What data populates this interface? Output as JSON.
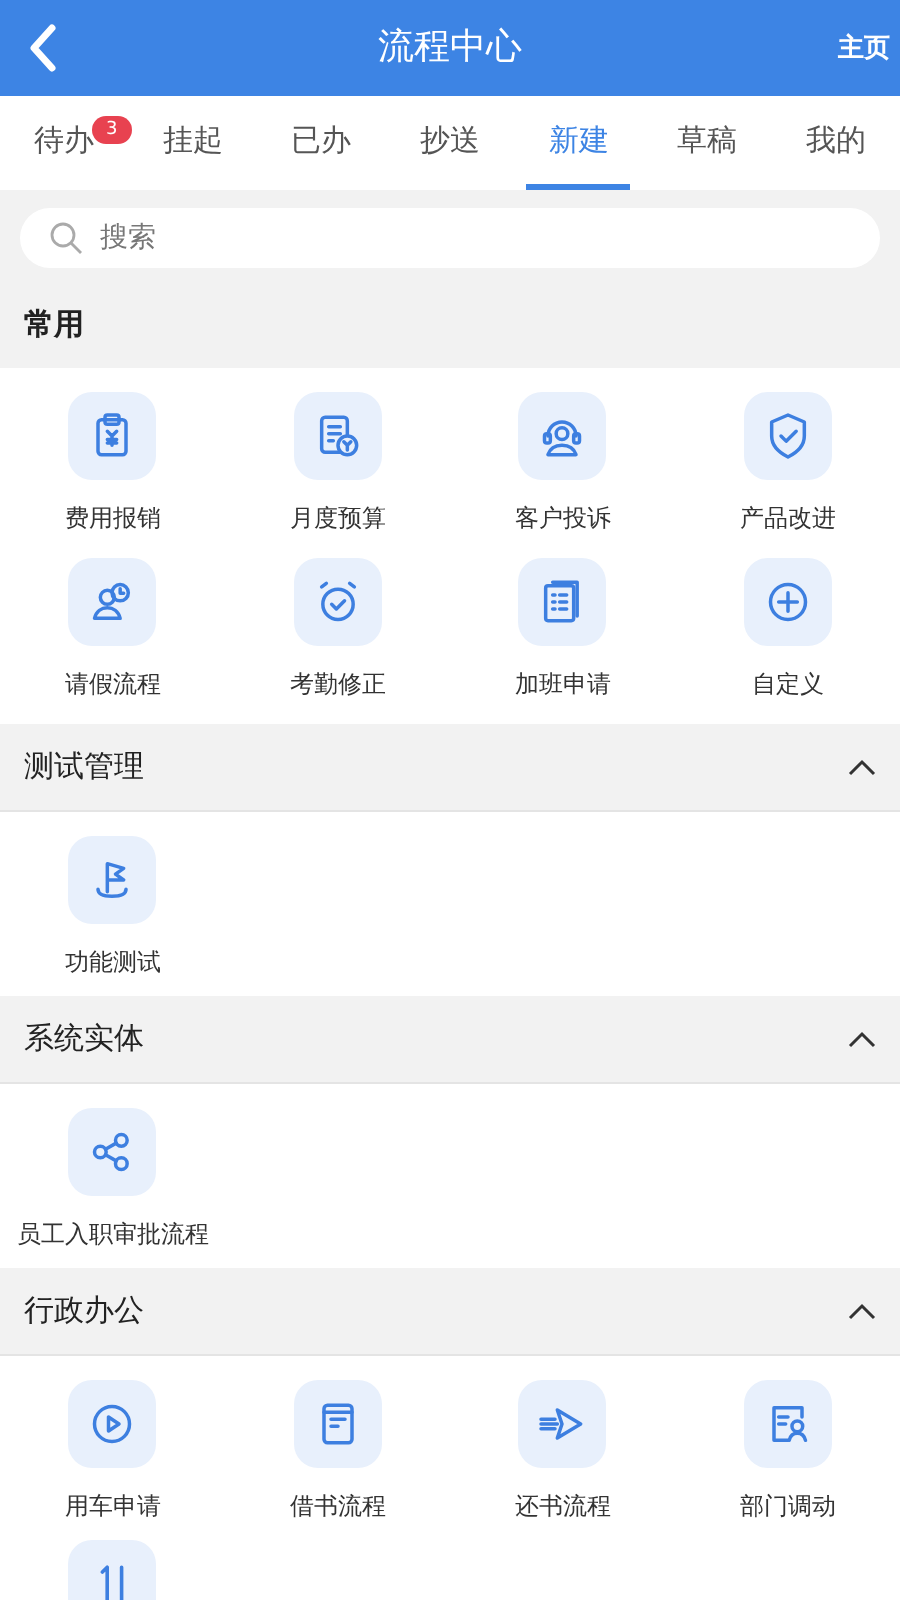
{
  "header": {
    "title": "流程中心",
    "action": "主页"
  },
  "tabs": [
    {
      "label": "待办",
      "badge": "3",
      "selected": false
    },
    {
      "label": "挂起",
      "selected": false
    },
    {
      "label": "已办",
      "selected": false
    },
    {
      "label": "抄送",
      "selected": false
    },
    {
      "label": "新建",
      "selected": true
    },
    {
      "label": "草稿",
      "selected": false
    },
    {
      "label": "我的",
      "selected": false
    }
  ],
  "search": {
    "placeholder": "搜索"
  },
  "common": {
    "title": "常用",
    "items": [
      {
        "label": "费用报销",
        "kind": "receipt"
      },
      {
        "label": "月度预算",
        "kind": "budget"
      },
      {
        "label": "客户投诉",
        "kind": "headset"
      },
      {
        "label": "产品改进",
        "kind": "shield"
      },
      {
        "label": "请假流程",
        "kind": "leave"
      },
      {
        "label": "考勤修正",
        "kind": "alarm"
      },
      {
        "label": "加班申请",
        "kind": "list"
      },
      {
        "label": "自定义",
        "kind": "plus"
      }
    ]
  },
  "groups": [
    {
      "title": "测试管理",
      "expanded": true,
      "items": [
        {
          "label": "功能测试",
          "kind": "flag"
        }
      ]
    },
    {
      "title": "系统实体",
      "expanded": true,
      "items": [
        {
          "label": "员工入职审批流程",
          "kind": "share"
        }
      ]
    },
    {
      "title": "行政办公",
      "expanded": true,
      "items": [
        {
          "label": "用车申请",
          "kind": "play"
        },
        {
          "label": "借书流程",
          "kind": "book"
        },
        {
          "label": "还书流程",
          "kind": "plane"
        },
        {
          "label": "部门调动",
          "kind": "profile"
        },
        {
          "kind": "sort"
        }
      ]
    }
  ]
}
